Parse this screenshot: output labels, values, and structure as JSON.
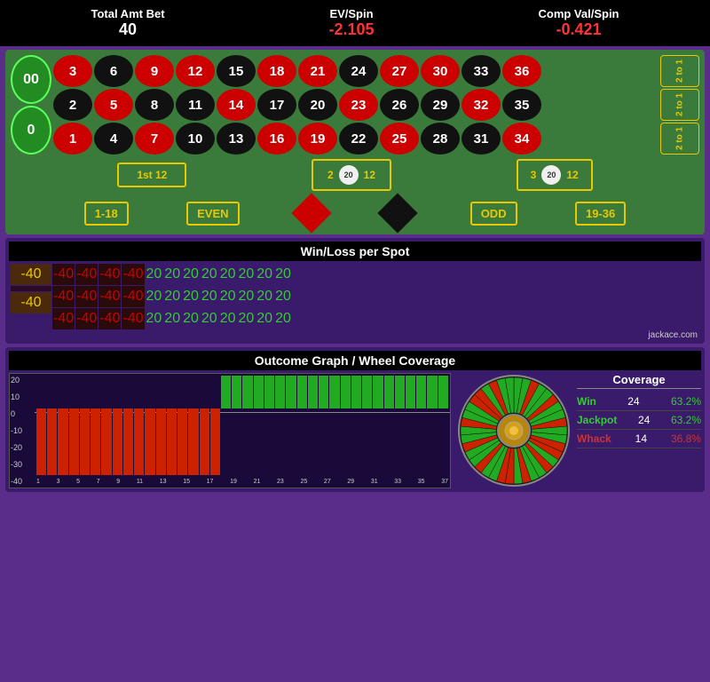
{
  "header": {
    "total_amt_bet_label": "Total Amt Bet",
    "total_amt_bet_value": "40",
    "ev_spin_label": "EV/Spin",
    "ev_spin_value": "-2.105",
    "comp_val_label": "Comp Val/Spin",
    "comp_val_value": "-0.421"
  },
  "table": {
    "zero": "0",
    "double_zero": "00",
    "numbers": [
      [
        "3",
        "6",
        "9",
        "12",
        "15",
        "18",
        "21",
        "24",
        "27",
        "30",
        "33",
        "36"
      ],
      [
        "2",
        "5",
        "8",
        "11",
        "14",
        "17",
        "20",
        "23",
        "26",
        "29",
        "32",
        "35"
      ],
      [
        "1",
        "4",
        "7",
        "10",
        "13",
        "16",
        "19",
        "22",
        "25",
        "28",
        "31",
        "34"
      ]
    ],
    "colors": {
      "3": "red",
      "6": "black",
      "9": "red",
      "12": "red",
      "15": "black",
      "18": "red",
      "21": "red",
      "24": "black",
      "27": "red",
      "30": "red",
      "33": "black",
      "36": "red",
      "2": "black",
      "5": "red",
      "8": "black",
      "11": "black",
      "14": "red",
      "17": "black",
      "20": "black",
      "23": "red",
      "26": "black",
      "29": "black",
      "32": "red",
      "35": "black",
      "1": "red",
      "4": "black",
      "7": "red",
      "10": "black",
      "13": "black",
      "16": "red",
      "19": "red",
      "22": "black",
      "25": "red",
      "28": "black",
      "31": "black",
      "34": "red"
    },
    "side_bets": [
      "2 to 1",
      "2 to 1",
      "2 to 1"
    ],
    "dozens": {
      "first": "1st 12",
      "second": "2nd 12",
      "third": "3rd 12",
      "chip1": "20",
      "chip2": "20"
    },
    "bottom_bets": {
      "low": "1-18",
      "even": "EVEN",
      "odd": "ODD",
      "high": "19-36"
    }
  },
  "winloss": {
    "title": "Win/Loss per Spot",
    "rows": [
      {
        "label": "-40",
        "values": [
          "-40",
          "-40",
          "-40",
          "-40",
          "20",
          "20",
          "20",
          "20",
          "20",
          "20",
          "20",
          "20"
        ]
      },
      {
        "label": "",
        "values": [
          "-40",
          "-40",
          "-40",
          "-40",
          "20",
          "20",
          "20",
          "20",
          "20",
          "20",
          "20",
          "20"
        ]
      },
      {
        "label": "-40",
        "values": [
          "-40",
          "-40",
          "-40",
          "-40",
          "20",
          "20",
          "20",
          "20",
          "20",
          "20",
          "20",
          "20"
        ]
      }
    ],
    "credit": "jackace.com"
  },
  "outcome": {
    "title": "Outcome Graph / Wheel Coverage",
    "x_labels": [
      "1",
      "3",
      "5",
      "7",
      "9",
      "11",
      "13",
      "15",
      "17",
      "19",
      "21",
      "23",
      "25",
      "27",
      "29",
      "31",
      "33",
      "35",
      "37"
    ],
    "y_labels": [
      "20",
      "10",
      "0",
      "-10",
      "-20",
      "-30",
      "-40"
    ],
    "bars": [
      -40,
      -40,
      -40,
      -40,
      -40,
      -40,
      -40,
      -40,
      -40,
      -40,
      -40,
      -40,
      -40,
      -40,
      -40,
      -40,
      -40,
      20,
      20,
      20,
      20,
      20,
      20,
      20,
      20,
      20,
      20,
      20,
      20,
      20,
      20,
      20,
      20,
      20,
      20,
      20,
      20,
      20
    ],
    "coverage": {
      "title": "Coverage",
      "win_label": "Win",
      "win_count": "24",
      "win_pct": "63.2%",
      "jackpot_label": "Jackpot",
      "jackpot_count": "24",
      "jackpot_pct": "63.2%",
      "whack_label": "Whack",
      "whack_count": "14",
      "whack_pct": "36.8%"
    }
  }
}
